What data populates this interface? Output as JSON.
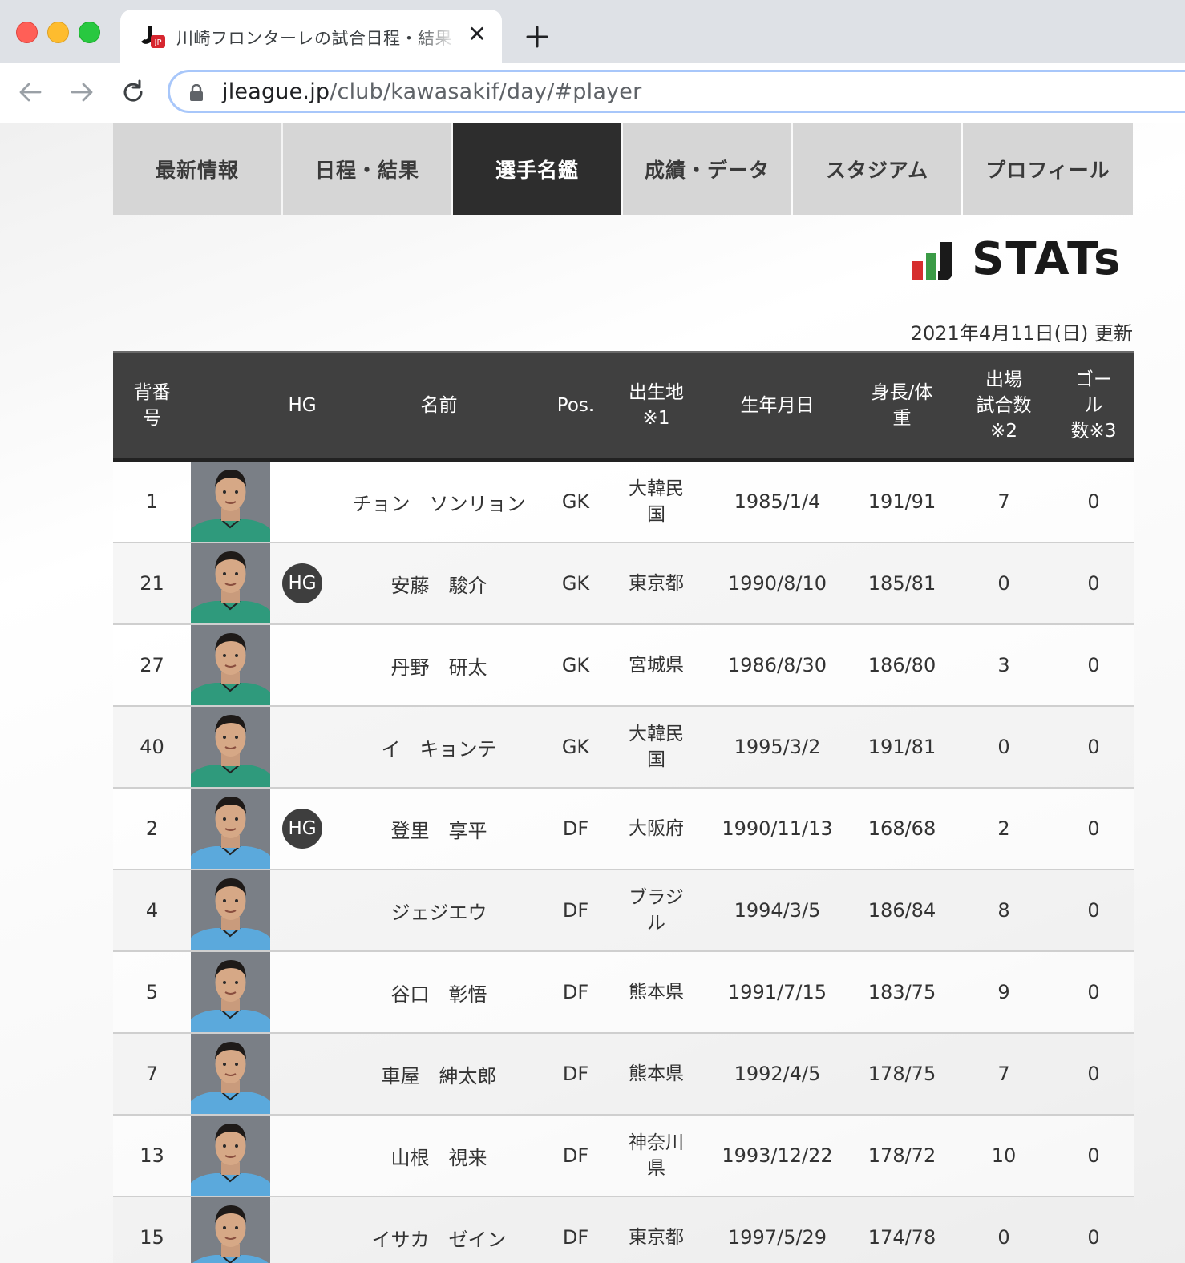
{
  "browser": {
    "tab_title": "川崎フロンターレの試合日程・結果",
    "url_host": "jleague.jp",
    "url_path": "/club/kawasakif/day/#player",
    "favicon_text": "JP"
  },
  "club_nav": [
    {
      "label": "最新情報"
    },
    {
      "label": "日程・結果"
    },
    {
      "label": "選手名鑑"
    },
    {
      "label": "成績・データ"
    },
    {
      "label": "スタジアム"
    },
    {
      "label": "プロフィール"
    }
  ],
  "stats_logo": {
    "text": "STATs",
    "colors": [
      "#d62e2e",
      "#3b9b46",
      "#1a1a1a"
    ]
  },
  "updated": "2021年4月11日(日) 更新",
  "table": {
    "headers": {
      "number": "背番\n号",
      "photo": "",
      "hg": "HG",
      "name": "名前",
      "pos": "Pos.",
      "birthplace": "出生地\n※1",
      "birthdate": "生年月日",
      "height_weight": "身長/体\n重",
      "appearances": "出場\n試合数\n※2",
      "goals": "ゴー\nル\n数※3"
    },
    "rows": [
      {
        "number": "1",
        "hg": "",
        "name": "チョン　ソンリョン",
        "pos": "GK",
        "birthplace": "大韓民\n国",
        "birthdate": "1985/1/4",
        "hw": "191/91",
        "apps": "7",
        "goals": "0",
        "kit": "green"
      },
      {
        "number": "21",
        "hg": "HG",
        "name": "安藤　駿介",
        "pos": "GK",
        "birthplace": "東京都",
        "birthdate": "1990/8/10",
        "hw": "185/81",
        "apps": "0",
        "goals": "0",
        "kit": "green"
      },
      {
        "number": "27",
        "hg": "",
        "name": "丹野　研太",
        "pos": "GK",
        "birthplace": "宮城県",
        "birthdate": "1986/8/30",
        "hw": "186/80",
        "apps": "3",
        "goals": "0",
        "kit": "green"
      },
      {
        "number": "40",
        "hg": "",
        "name": "イ　キョンテ",
        "pos": "GK",
        "birthplace": "大韓民\n国",
        "birthdate": "1995/3/2",
        "hw": "191/81",
        "apps": "0",
        "goals": "0",
        "kit": "green"
      },
      {
        "number": "2",
        "hg": "HG",
        "name": "登里　享平",
        "pos": "DF",
        "birthplace": "大阪府",
        "birthdate": "1990/11/13",
        "hw": "168/68",
        "apps": "2",
        "goals": "0",
        "kit": "blue"
      },
      {
        "number": "4",
        "hg": "",
        "name": "ジェジエウ",
        "pos": "DF",
        "birthplace": "ブラジ\nル",
        "birthdate": "1994/3/5",
        "hw": "186/84",
        "apps": "8",
        "goals": "0",
        "kit": "blue"
      },
      {
        "number": "5",
        "hg": "",
        "name": "谷口　彰悟",
        "pos": "DF",
        "birthplace": "熊本県",
        "birthdate": "1991/7/15",
        "hw": "183/75",
        "apps": "9",
        "goals": "0",
        "kit": "blue"
      },
      {
        "number": "7",
        "hg": "",
        "name": "車屋　紳太郎",
        "pos": "DF",
        "birthplace": "熊本県",
        "birthdate": "1992/4/5",
        "hw": "178/75",
        "apps": "7",
        "goals": "0",
        "kit": "blue"
      },
      {
        "number": "13",
        "hg": "",
        "name": "山根　視来",
        "pos": "DF",
        "birthplace": "神奈川\n県",
        "birthdate": "1993/12/22",
        "hw": "178/72",
        "apps": "10",
        "goals": "0",
        "kit": "blue"
      },
      {
        "number": "15",
        "hg": "",
        "name": "イサカ　ゼイン",
        "pos": "DF",
        "birthplace": "東京都",
        "birthdate": "1997/5/29",
        "hw": "174/78",
        "apps": "0",
        "goals": "0",
        "kit": "blue"
      }
    ]
  },
  "colors": {
    "nav_bg": "#d6d6d6",
    "nav_active_bg": "#2d2d2d",
    "table_header_bg": "#404040",
    "hg_badge_bg": "#3e3e3e",
    "kit_green": "#2f9a7c",
    "kit_blue": "#5ba9dc"
  }
}
